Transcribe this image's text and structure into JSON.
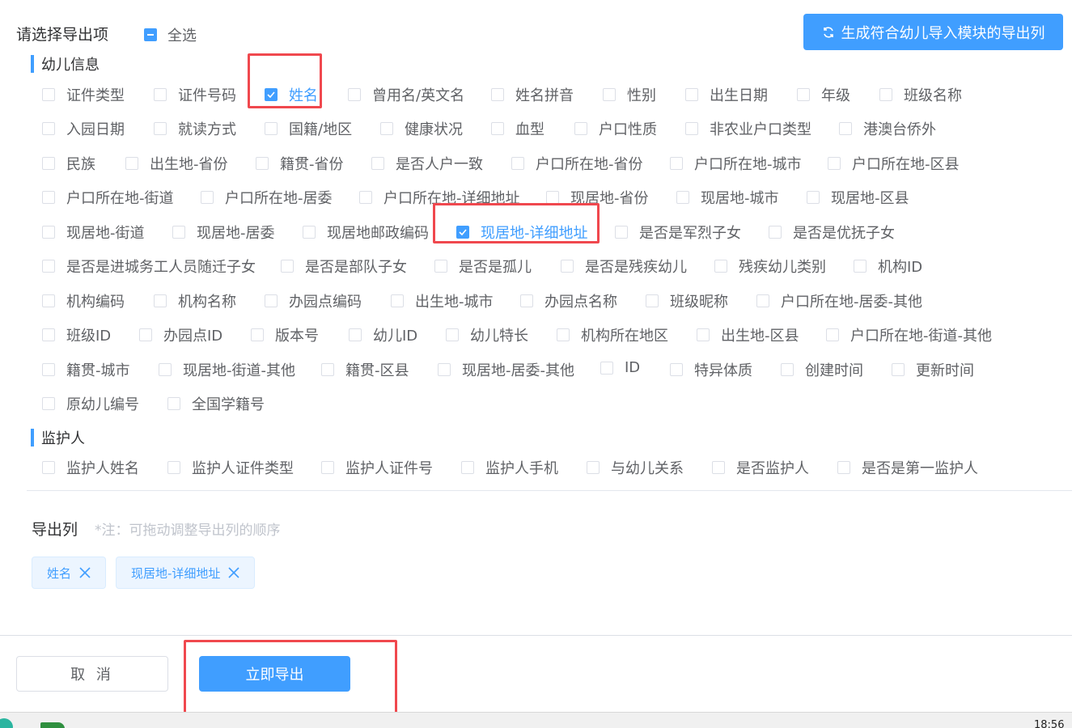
{
  "header": {
    "title": "请选择导出项",
    "select_all_label": "全选",
    "generate_button_label": "生成符合幼儿导入模块的导出列"
  },
  "sections": [
    {
      "title": "幼儿信息",
      "rows": [
        [
          {
            "label": "证件类型",
            "checked": false
          },
          {
            "label": "证件号码",
            "checked": false
          },
          {
            "label": "姓名",
            "checked": true
          },
          {
            "label": "曾用名/英文名",
            "checked": false
          },
          {
            "label": "姓名拼音",
            "checked": false
          },
          {
            "label": "性别",
            "checked": false
          },
          {
            "label": "出生日期",
            "checked": false
          },
          {
            "label": "年级",
            "checked": false
          },
          {
            "label": "班级名称",
            "checked": false
          }
        ],
        [
          {
            "label": "入园日期",
            "checked": false
          },
          {
            "label": "就读方式",
            "checked": false
          },
          {
            "label": "国籍/地区",
            "checked": false
          },
          {
            "label": "健康状况",
            "checked": false
          },
          {
            "label": "血型",
            "checked": false
          },
          {
            "label": "户口性质",
            "checked": false
          },
          {
            "label": "非农业户口类型",
            "checked": false
          },
          {
            "label": "港澳台侨外",
            "checked": false
          }
        ],
        [
          {
            "label": "民族",
            "checked": false
          },
          {
            "label": "出生地-省份",
            "checked": false
          },
          {
            "label": "籍贯-省份",
            "checked": false
          },
          {
            "label": "是否人户一致",
            "checked": false
          },
          {
            "label": "户口所在地-省份",
            "checked": false
          },
          {
            "label": "户口所在地-城市",
            "checked": false
          },
          {
            "label": "户口所在地-区县",
            "checked": false
          }
        ],
        [
          {
            "label": "户口所在地-街道",
            "checked": false
          },
          {
            "label": "户口所在地-居委",
            "checked": false
          },
          {
            "label": "户口所在地-详细地址",
            "checked": false
          },
          {
            "label": "现居地-省份",
            "checked": false
          },
          {
            "label": "现居地-城市",
            "checked": false
          },
          {
            "label": "现居地-区县",
            "checked": false
          }
        ],
        [
          {
            "label": "现居地-街道",
            "checked": false
          },
          {
            "label": "现居地-居委",
            "checked": false
          },
          {
            "label": "现居地邮政编码",
            "checked": false
          },
          {
            "label": "现居地-详细地址",
            "checked": true
          },
          {
            "label": "是否是军烈子女",
            "checked": false
          },
          {
            "label": "是否是优抚子女",
            "checked": false
          }
        ],
        [
          {
            "label": "是否是进城务工人员随迁子女",
            "checked": false
          },
          {
            "label": "是否是部队子女",
            "checked": false
          },
          {
            "label": "是否是孤儿",
            "checked": false
          },
          {
            "label": "是否是残疾幼儿",
            "checked": false
          },
          {
            "label": "残疾幼儿类别",
            "checked": false
          },
          {
            "label": "机构ID",
            "checked": false
          }
        ],
        [
          {
            "label": "机构编码",
            "checked": false
          },
          {
            "label": "机构名称",
            "checked": false
          },
          {
            "label": "办园点编码",
            "checked": false
          },
          {
            "label": "出生地-城市",
            "checked": false
          },
          {
            "label": "办园点名称",
            "checked": false
          },
          {
            "label": "班级昵称",
            "checked": false
          },
          {
            "label": "户口所在地-居委-其他",
            "checked": false
          }
        ],
        [
          {
            "label": "班级ID",
            "checked": false
          },
          {
            "label": "办园点ID",
            "checked": false
          },
          {
            "label": "版本号",
            "checked": false
          },
          {
            "label": "幼儿ID",
            "checked": false
          },
          {
            "label": "幼儿特长",
            "checked": false
          },
          {
            "label": "机构所在地区",
            "checked": false
          },
          {
            "label": "出生地-区县",
            "checked": false
          },
          {
            "label": "户口所在地-街道-其他",
            "checked": false
          }
        ],
        [
          {
            "label": "籍贯-城市",
            "checked": false
          },
          {
            "label": "现居地-街道-其他",
            "checked": false
          },
          {
            "label": "籍贯-区县",
            "checked": false
          },
          {
            "label": "现居地-居委-其他",
            "checked": false
          },
          {
            "label": "ID",
            "checked": false
          },
          {
            "label": "特异体质",
            "checked": false
          },
          {
            "label": "创建时间",
            "checked": false
          },
          {
            "label": "更新时间",
            "checked": false
          }
        ],
        [
          {
            "label": "原幼儿编号",
            "checked": false
          },
          {
            "label": "全国学籍号",
            "checked": false
          }
        ]
      ]
    },
    {
      "title": "监护人",
      "rows": [
        [
          {
            "label": "监护人姓名",
            "checked": false
          },
          {
            "label": "监护人证件类型",
            "checked": false
          },
          {
            "label": "监护人证件号",
            "checked": false
          },
          {
            "label": "监护人手机",
            "checked": false
          },
          {
            "label": "与幼儿关系",
            "checked": false
          },
          {
            "label": "是否监护人",
            "checked": false
          },
          {
            "label": "是否是第一监护人",
            "checked": false
          }
        ]
      ]
    }
  ],
  "export": {
    "label": "导出列",
    "note": "*注：可拖动调整导出列的顺序",
    "tags": [
      "姓名",
      "现居地-详细地址"
    ]
  },
  "footer": {
    "cancel_label": "取 消",
    "export_label": "立即导出"
  },
  "taskbar": {
    "clock": "18:56"
  },
  "colors": {
    "primary": "#409eff",
    "highlight": "#f0484e"
  }
}
